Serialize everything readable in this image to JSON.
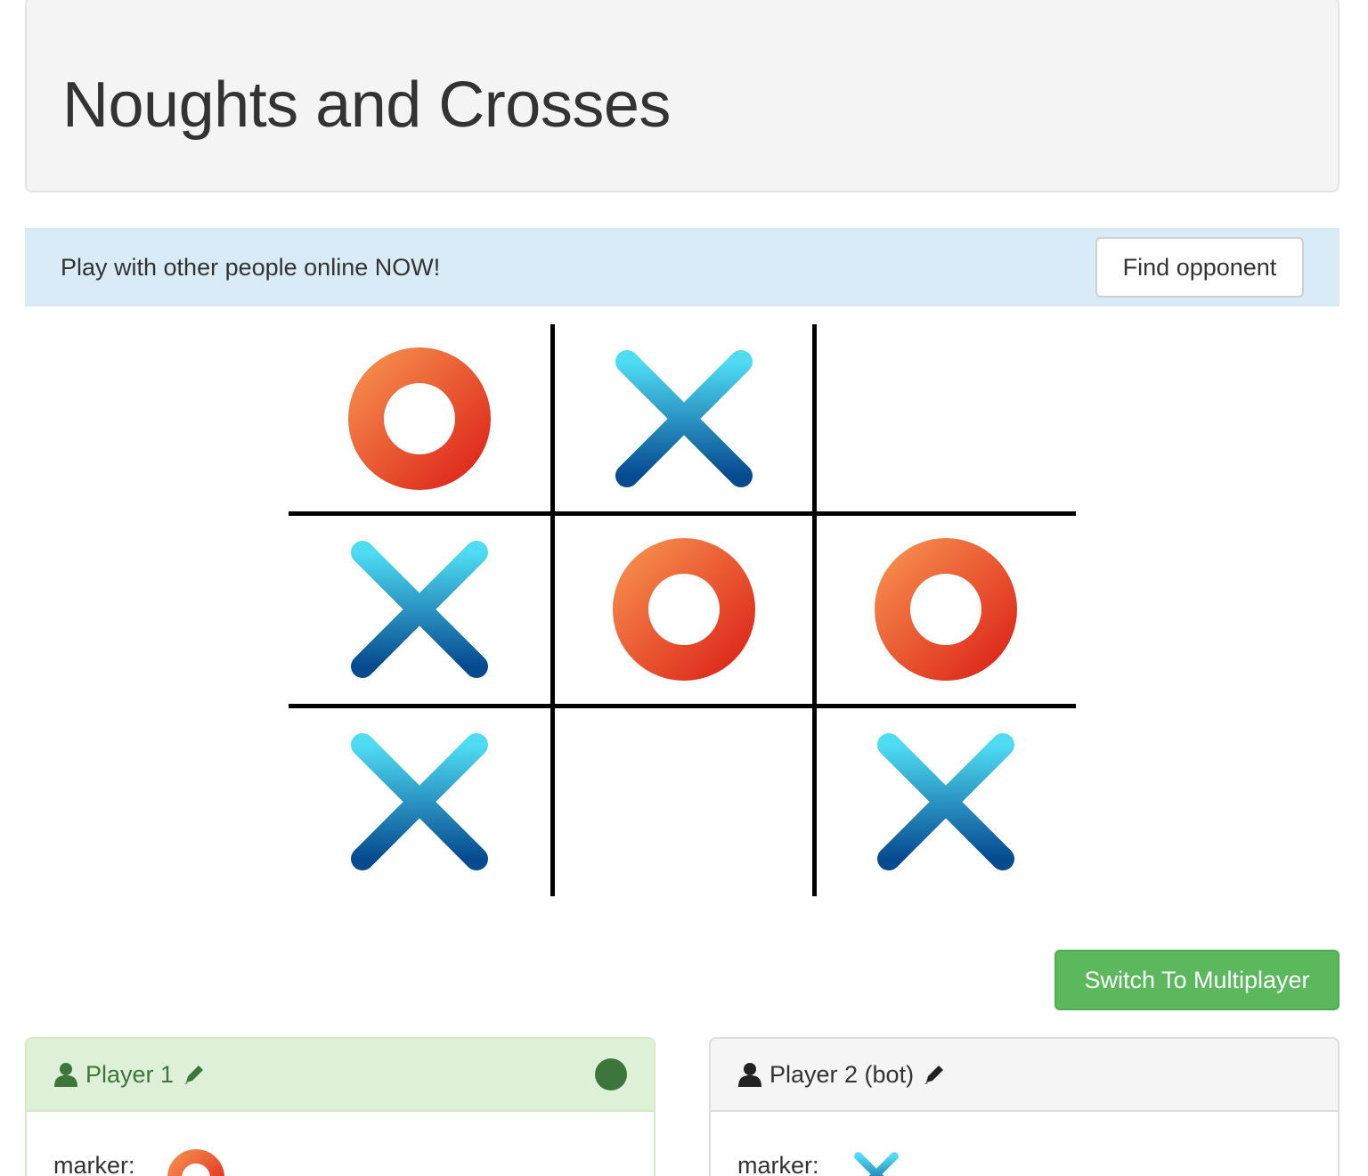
{
  "header": {
    "title": "Noughts and Crosses"
  },
  "alert": {
    "message": "Play with other people online NOW!",
    "button_label": "Find opponent"
  },
  "board": {
    "cells": [
      "O",
      "X",
      "",
      "X",
      "O",
      "O",
      "X",
      "",
      "X"
    ]
  },
  "controls": {
    "switch_label": "Switch To Multiplayer"
  },
  "players": [
    {
      "name": "Player 1",
      "marker_label": "marker:",
      "marker": "O",
      "active": true
    },
    {
      "name": "Player 2 (bot)",
      "marker_label": "marker:",
      "marker": "X",
      "active": false
    }
  ],
  "colors": {
    "nought_start": "#f5894a",
    "nought_end": "#de2a1c",
    "cross_start": "#4fdcf3",
    "cross_end": "#064a90",
    "active_green": "#3c763d",
    "button_green": "#5cb85c",
    "alert_bg": "#d9ebf6"
  },
  "icons": {
    "user": "user-icon",
    "edit": "pencil-icon",
    "status": "active-dot-icon"
  }
}
